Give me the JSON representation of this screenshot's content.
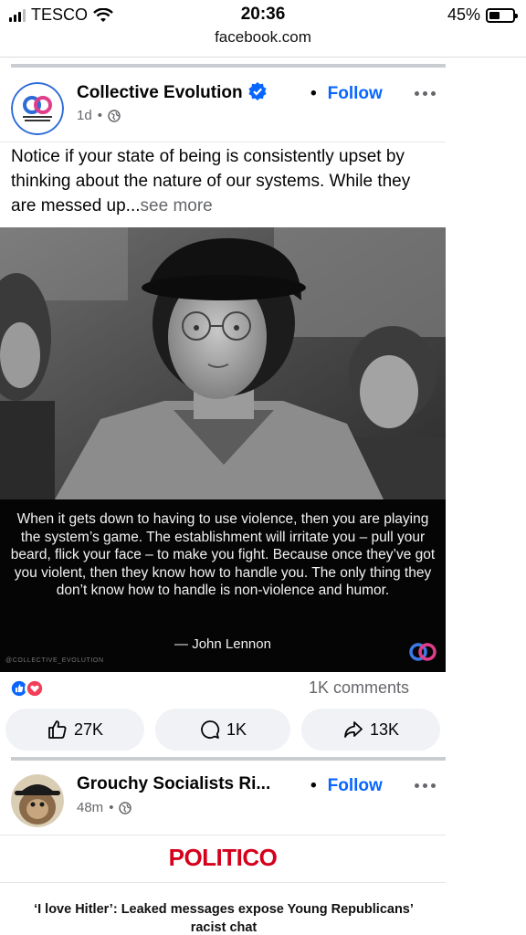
{
  "status_bar": {
    "carrier": "TESCO",
    "time": "20:36",
    "battery_percent": "45%",
    "battery_level": 0.45
  },
  "browser": {
    "url": "facebook.com"
  },
  "post1": {
    "page_name": "Collective Evolution",
    "age": "1d",
    "follow_label": "Follow",
    "caption": "Notice if your state of being is consistently upset by thinking about the nature of our systems. While they are messed up...",
    "see_more": "see more",
    "quote": "When it gets down to having to use violence, then you are playing the system’s game. The establishment will irritate you – pull your beard, flick your face – to make you fight. Because once they’ve got you violent, then they know how to handle you. The only thing they don’t know how to handle is non-violence and humor.",
    "quote_author": "— John Lennon",
    "watermark": "@COLLECTIVE_EVOLUTION",
    "comments": "1K comments",
    "actions": {
      "like": "27K",
      "comment": "1K",
      "share": "13K"
    }
  },
  "post2": {
    "page_name": "Grouchy Socialists Ri...",
    "age": "48m",
    "follow_label": "Follow",
    "publisher": "POLITICO",
    "headline": "‘I love Hitler’: Leaked messages expose Young Republicans’ racist chat"
  },
  "colors": {
    "accent": "#0866ff",
    "politico_red": "#d5001c",
    "secondary_text": "#65676b",
    "button_bg": "#f0f2f5"
  },
  "icons": [
    "wifi-icon",
    "verified-badge-icon",
    "globe-icon",
    "more-icon",
    "like-reaction-icon",
    "love-reaction-icon",
    "thumbs-up-icon",
    "comment-icon",
    "share-icon"
  ]
}
